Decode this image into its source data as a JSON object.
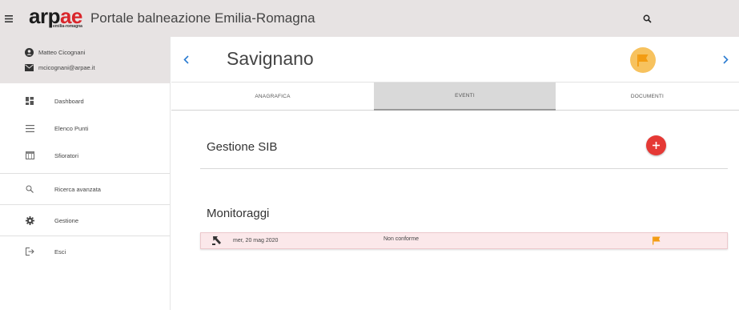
{
  "header": {
    "logo_text_a": "arp",
    "logo_text_b": "ae",
    "logo_sub": "emilia-romagna",
    "app_title": "Portale balneazione Emilia-Romagna"
  },
  "user": {
    "name": "Matteo Cicognani",
    "email": "mcicognani@arpae.it"
  },
  "sidebar": {
    "items": [
      {
        "label": "Dashboard",
        "icon": "dashboard-icon"
      },
      {
        "label": "Elenco Punti",
        "icon": "list-icon"
      },
      {
        "label": "Sfioratori",
        "icon": "overflow-icon"
      },
      {
        "label": "Ricerca avanzata",
        "icon": "search-icon"
      },
      {
        "label": "Gestione",
        "icon": "gear-icon"
      },
      {
        "label": "Esci",
        "icon": "logout-icon"
      }
    ]
  },
  "station": {
    "name": "Savignano",
    "status_color": "#f39c12"
  },
  "tabs": [
    {
      "label": "ANAGRAFICA",
      "active": false
    },
    {
      "label": "EVENTI",
      "active": true
    },
    {
      "label": "DOCUMENTI",
      "active": false
    }
  ],
  "sections": {
    "sib_title": "Gestione SIB",
    "monitoring_title": "Monitoraggi"
  },
  "monitoring": [
    {
      "date": "mer, 20 mag 2020",
      "status": "Non conforme",
      "flag_color": "#f39c12"
    }
  ],
  "colors": {
    "accent_blue": "#2a7bd1",
    "add_red": "#e53935",
    "logo_red": "#d9262b"
  }
}
